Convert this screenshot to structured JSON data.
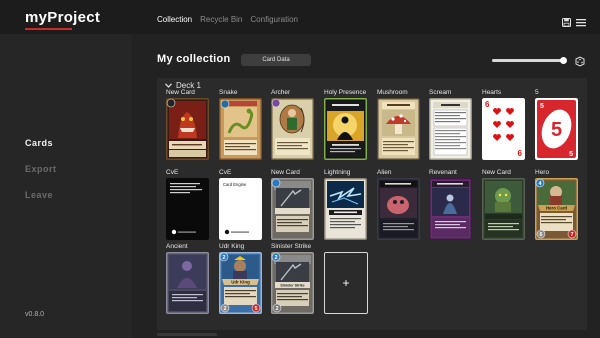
{
  "app": {
    "title": "myProject",
    "version": "v0.8.0",
    "accent": "#c92a2a"
  },
  "topnav": {
    "items": [
      "Collection",
      "Recycle Bin",
      "Configuration"
    ],
    "active": "Collection"
  },
  "sidebar": {
    "items": [
      "Cards",
      "Export",
      "Leave"
    ],
    "active": "Cards"
  },
  "main": {
    "title": "My collection",
    "card_data_button": "Card Data",
    "zoom_fraction": 0.97
  },
  "deck": {
    "name": "Deck 1",
    "cards": [
      {
        "label": "New Card",
        "art": "red-monster"
      },
      {
        "label": "Snake",
        "art": "snake"
      },
      {
        "label": "Archer",
        "art": "archer"
      },
      {
        "label": "Holy Presence",
        "art": "holy"
      },
      {
        "label": "Mushroom",
        "art": "mushroom"
      },
      {
        "label": "Scream",
        "art": "scream"
      },
      {
        "label": "Hearts",
        "art": "hearts",
        "face": "6"
      },
      {
        "label": "5",
        "art": "uno",
        "face": "5"
      },
      {
        "label": "CvE",
        "art": "cve-black"
      },
      {
        "label": "CvE",
        "art": "cve-white",
        "title": "Card Engine"
      },
      {
        "label": "New Card",
        "art": "sinister"
      },
      {
        "label": "Lightning",
        "art": "lightning"
      },
      {
        "label": "Alien",
        "art": "alien"
      },
      {
        "label": "Revenant",
        "art": "revenant"
      },
      {
        "label": "New Card",
        "art": "troll"
      },
      {
        "label": "Hero",
        "art": "hero",
        "title": "Hero Card",
        "mana": "4",
        "attack": "6",
        "health": "7"
      },
      {
        "label": "Ancient",
        "art": "ancient"
      },
      {
        "label": "Udr King",
        "art": "udr",
        "title": "Udr King",
        "mana": "2",
        "attack": "2",
        "health": "5"
      },
      {
        "label": "Sinister Strike",
        "art": "sinister2",
        "title": "Sinister Strike",
        "mana": "2",
        "attack": "2"
      }
    ],
    "add_label": "+"
  }
}
